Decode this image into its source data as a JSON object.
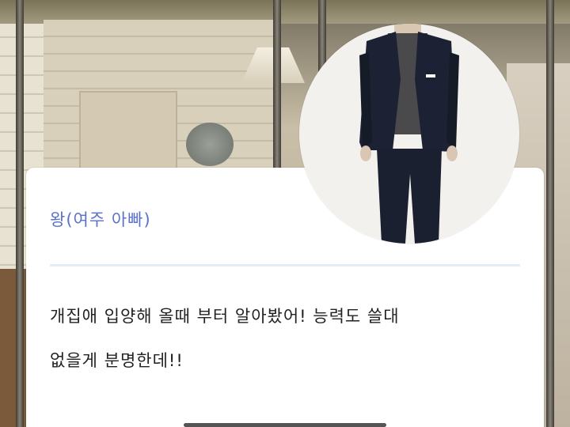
{
  "dialogue": {
    "speaker": "왕(여주 아빠)",
    "lines": [
      "개집애 입양해 올때 부터 알아봤어! 능력도 쓸대",
      "없을게 분명한데!!"
    ]
  },
  "avatar": {
    "icon": "suited-man-portrait"
  },
  "colors": {
    "speaker": "#5a72c8",
    "divider": "#e3edf3",
    "text": "#222222",
    "card": "#ffffff"
  }
}
